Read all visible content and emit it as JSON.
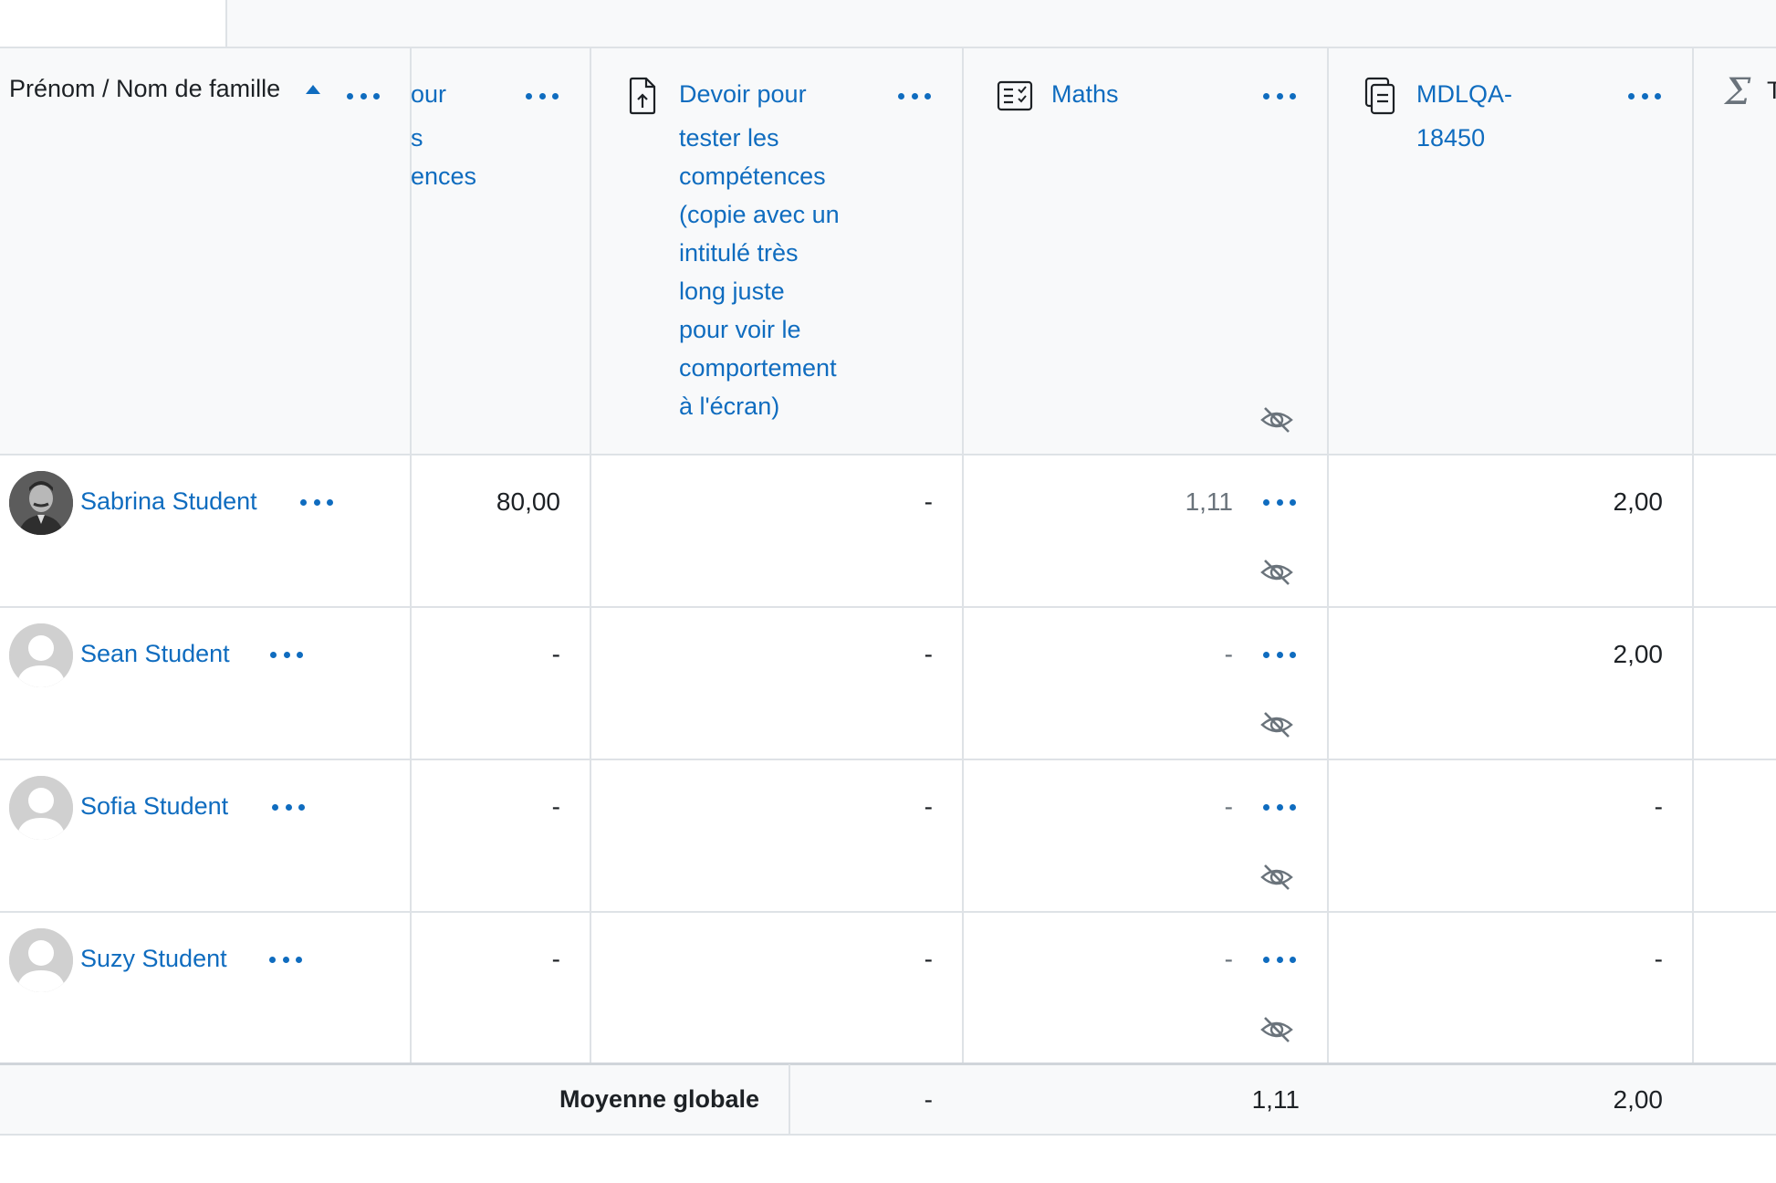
{
  "header": {
    "name_column": "Prénom / Nom de famille",
    "col_partial_lines": [
      "our",
      "s",
      "ences"
    ],
    "col_devoir_lines": [
      "Devoir pour",
      "tester les",
      "compétences",
      "(copie avec un",
      "intitulé très",
      "long juste",
      "pour voir le",
      "comportement",
      "à l'écran)"
    ],
    "col_maths": "Maths",
    "col_mdlqa_lines": [
      "MDLQA-",
      "18450"
    ],
    "col_total_partial": "T"
  },
  "rows": [
    {
      "name": "Sabrina Student",
      "partial": "80,00",
      "devoir": "-",
      "maths": "1,11",
      "mdlqa": "2,00"
    },
    {
      "name": "Sean Student",
      "partial": "-",
      "devoir": "-",
      "maths": "-",
      "mdlqa": "2,00"
    },
    {
      "name": "Sofia Student",
      "partial": "-",
      "devoir": "-",
      "maths": "-",
      "mdlqa": "-"
    },
    {
      "name": "Suzy Student",
      "partial": "-",
      "devoir": "-",
      "maths": "-",
      "mdlqa": "-"
    }
  ],
  "footer": {
    "label": "Moyenne globale",
    "devoir": "-",
    "maths": "1,11",
    "mdlqa": "2,00"
  },
  "colors": {
    "link": "#0f6cbf",
    "header_bg": "#f8f9fa",
    "border": "#dee2e6"
  },
  "icons": {
    "sort": "sort-ascending-icon",
    "menu": "ellipsis-menu-icon",
    "assign": "assignment-upload-icon",
    "quiz": "quiz-icon",
    "lesson": "copy-document-icon",
    "hidden": "eye-slash-icon",
    "sum": "sigma-icon"
  }
}
